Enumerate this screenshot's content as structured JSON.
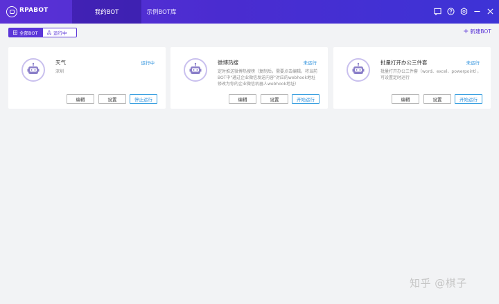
{
  "header": {
    "brand": "RPABOT",
    "tabs": [
      {
        "label": "我的BOT",
        "active": true
      },
      {
        "label": "示例BOT库",
        "active": false
      }
    ],
    "icons": [
      "feedback-icon",
      "help-icon",
      "settings-icon",
      "minimize-icon",
      "close-icon"
    ]
  },
  "filters": {
    "all_label": "全部BOT",
    "running_label": "运行中"
  },
  "new_bot_label": "新建BOT",
  "cards": [
    {
      "title": "天气",
      "status": "运行中",
      "description": "深圳",
      "edit_label": "编辑",
      "settings_label": "设置",
      "action_label": "停止运行"
    },
    {
      "title": "微博热搜",
      "status": "未运行",
      "description": "定时推送微博热搜榜（复制后，需要点击编辑，将当前BOT中\"通过企业微信发送内容\"对应的webhook地址修改为你的企业微信机器人webhook地址）",
      "edit_label": "编辑",
      "settings_label": "设置",
      "action_label": "开始运行"
    },
    {
      "title": "批量打开办公三件套",
      "status": "未运行",
      "description": "批量打开办公三件套（word、excel、powerpoint），可设置定时运行",
      "edit_label": "编辑",
      "settings_label": "设置",
      "action_label": "开始运行"
    }
  ],
  "watermark": "知乎 @棋子",
  "colors": {
    "header_start": "#5b31d6",
    "header_end": "#3d33d6",
    "accent": "#5b35d8",
    "status_blue": "#2a8fdc",
    "background": "#f2f3f5"
  }
}
